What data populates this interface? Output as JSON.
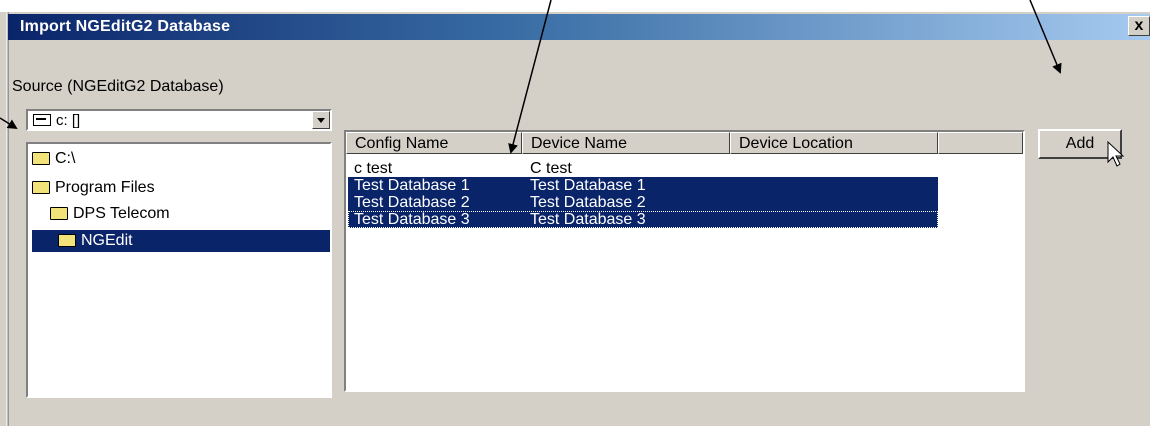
{
  "window": {
    "title": "Import NGEditG2 Database",
    "close_label": "x"
  },
  "source": {
    "label": "Source (NGEditG2 Database)",
    "drive_value": "c: []"
  },
  "folders": [
    {
      "name": "C:\\",
      "selected": false
    },
    {
      "name": "Program Files",
      "selected": false
    },
    {
      "name": "DPS Telecom",
      "selected": false
    },
    {
      "name": "NGEdit",
      "selected": true
    }
  ],
  "list": {
    "columns": [
      "Config Name",
      "Device Name",
      "Device Location"
    ],
    "rows": [
      {
        "config": "c test",
        "device": "C test",
        "location": "",
        "selected": false
      },
      {
        "config": "Test Database 1",
        "device": "Test Database 1",
        "location": "",
        "selected": true
      },
      {
        "config": "Test Database 2",
        "device": "Test Database 2",
        "location": "",
        "selected": true
      },
      {
        "config": "Test Database 3",
        "device": "Test Database 3",
        "location": "",
        "selected": true
      }
    ]
  },
  "buttons": {
    "add": "Add"
  },
  "colors": {
    "selection": "#0a246a",
    "face": "#d4d0c8"
  }
}
